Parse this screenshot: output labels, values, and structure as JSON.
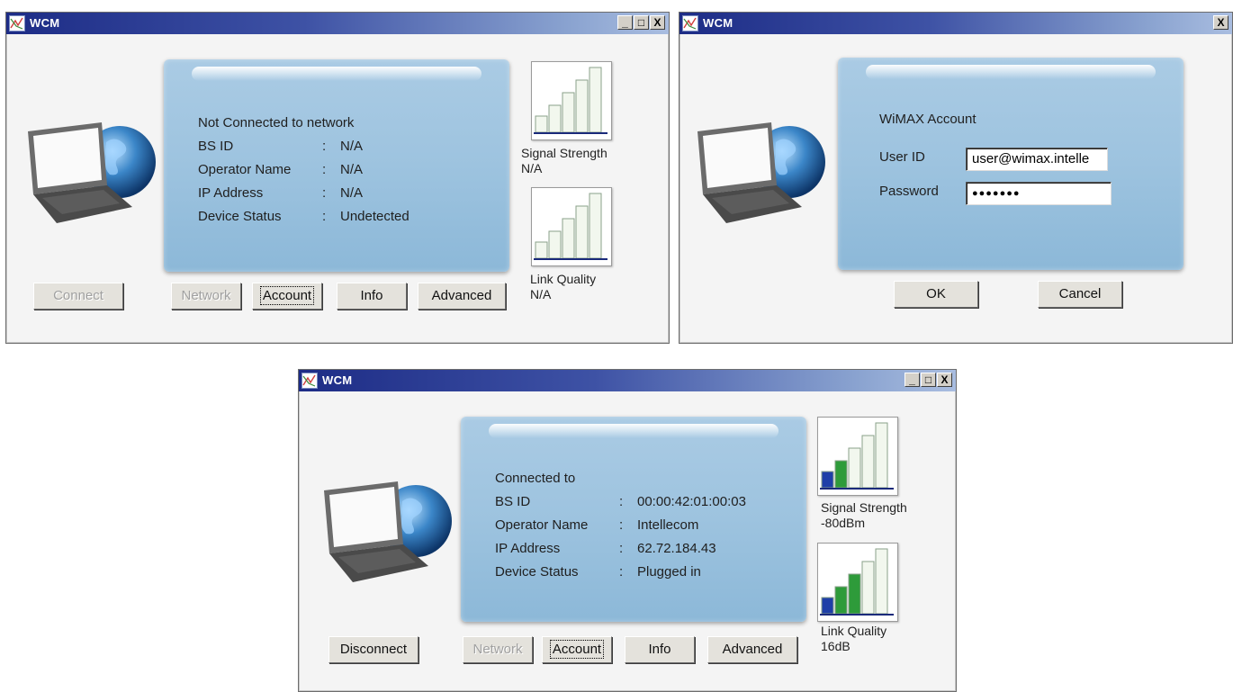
{
  "windows": [
    {
      "title": "WCM",
      "controls": [
        "_",
        "□",
        "X"
      ],
      "status": {
        "heading": "Not Connected to network",
        "rows": [
          {
            "key": "BS ID",
            "sep": ":",
            "value": "N/A"
          },
          {
            "key": "Operator Name",
            "sep": ":",
            "value": "N/A"
          },
          {
            "key": "IP Address",
            "sep": ":",
            "value": "N/A"
          },
          {
            "key": "Device Status",
            "sep": ":",
            "value": "Undetected"
          }
        ]
      },
      "signal": {
        "label": "Signal Strength",
        "value": "N/A",
        "bars_filled": 0
      },
      "link": {
        "label": "Link Quality",
        "value": "N/A",
        "bars_filled": 0
      },
      "buttons": {
        "connect": "Connect",
        "network": "Network",
        "account": "Account",
        "info": "Info",
        "advanced": "Advanced"
      }
    },
    {
      "title": "WCM",
      "controls": [
        "X"
      ],
      "account": {
        "heading": "WiMAX Account",
        "user_label": "User ID",
        "user_value": "user@wimax.intelle",
        "password_label": "Password",
        "password_value": "●●●●●●●"
      },
      "buttons": {
        "ok": "OK",
        "cancel": "Cancel"
      }
    },
    {
      "title": "WCM",
      "controls": [
        "_",
        "□",
        "X"
      ],
      "status": {
        "heading": "Connected to",
        "rows": [
          {
            "key": "BS ID",
            "sep": ":",
            "value": "00:00:42:01:00:03"
          },
          {
            "key": "Operator Name",
            "sep": ":",
            "value": "Intellecom"
          },
          {
            "key": "IP Address",
            "sep": ":",
            "value": "62.72.184.43"
          },
          {
            "key": "Device Status",
            "sep": ":",
            "value": "Plugged in"
          }
        ]
      },
      "signal": {
        "label": "Signal Strength",
        "value": "-80dBm",
        "bars_filled": 2
      },
      "link": {
        "label": "Link Quality",
        "value": "16dB",
        "bars_filled": 3
      },
      "buttons": {
        "disconnect": "Disconnect",
        "network": "Network",
        "account": "Account",
        "info": "Info",
        "advanced": "Advanced"
      }
    }
  ],
  "colors": {
    "title_start": "#1d2c86",
    "panel": "#9dc3df",
    "bar_blue": "#1f3fa8",
    "bar_green": "#2e9b3a"
  }
}
